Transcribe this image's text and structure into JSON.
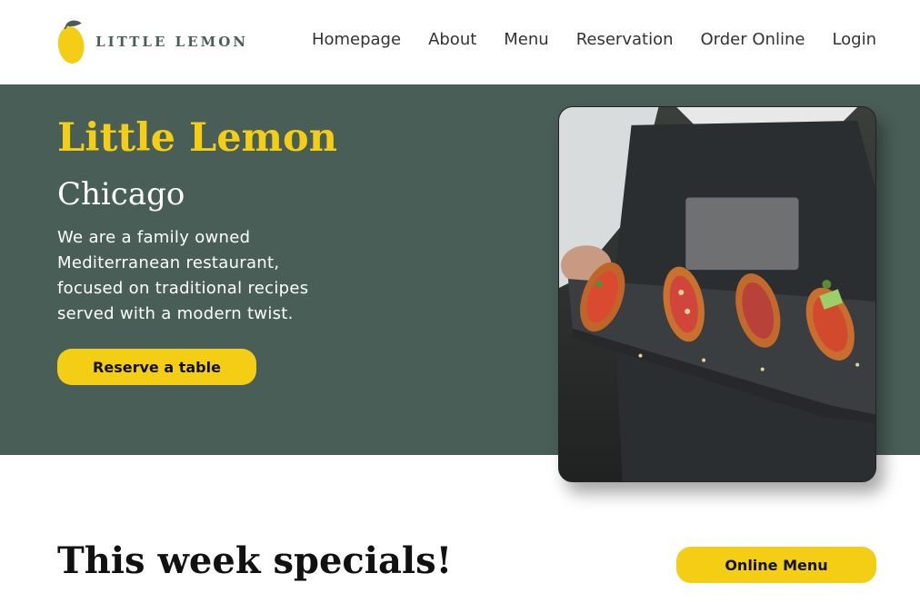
{
  "brand": {
    "logo_text": "LITTLE LEMON",
    "logo_icon": "lemon-icon",
    "colors": {
      "primary_green": "#495e57",
      "primary_yellow": "#f4ce14"
    }
  },
  "nav": {
    "items": [
      {
        "label": "Homepage"
      },
      {
        "label": "About"
      },
      {
        "label": "Menu"
      },
      {
        "label": "Reservation"
      },
      {
        "label": "Order Online"
      },
      {
        "label": "Login"
      }
    ]
  },
  "hero": {
    "title": "Little Lemon",
    "subtitle": "Chicago",
    "description": "We are a family owned Mediterranean restaurant, focused on traditional recipes served with a modern twist.",
    "cta_label": "Reserve a table",
    "image_alt": "waiter holding a slate tray of bruschetta"
  },
  "specials": {
    "title": "This week specials!",
    "menu_button_label": "Online Menu"
  }
}
